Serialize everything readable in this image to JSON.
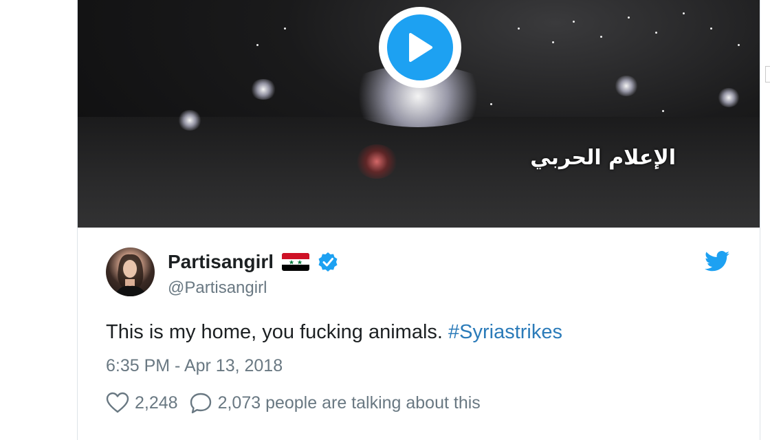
{
  "video": {
    "overlay_text": "الإعلام الحربي",
    "play_icon": "play-icon"
  },
  "tweet": {
    "display_name": "Partisangirl",
    "flag_icon": "syria-flag-icon",
    "verified_icon": "verified-badge-icon",
    "handle": "@Partisangirl",
    "brand_icon": "twitter-bird-icon",
    "text_main": "This is my home, you fucking animals. ",
    "hashtag": "#Syriastrikes",
    "timestamp": "6:35 PM - Apr 13, 2018",
    "likes": "2,248",
    "replies_text": "2,073 people are talking about this"
  },
  "colors": {
    "twitter_blue": "#1da1f2",
    "link_blue": "#2b7bb9",
    "text_dark": "#1c2022",
    "text_gray": "#697882"
  }
}
